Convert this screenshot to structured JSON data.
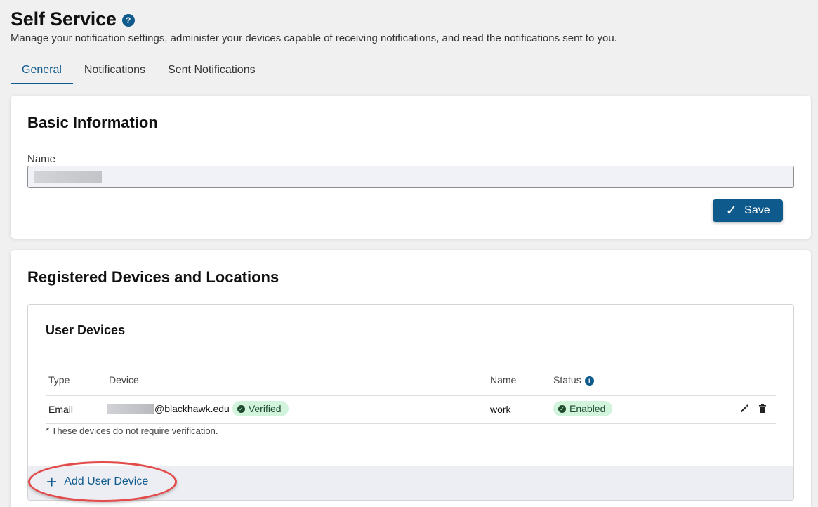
{
  "header": {
    "title": "Self Service",
    "help_icon": "question-circle-icon",
    "subtitle": "Manage your notification settings, administer your devices capable of receiving notifications, and read the notifications sent to you."
  },
  "tabs": [
    {
      "label": "General",
      "active": true
    },
    {
      "label": "Notifications",
      "active": false
    },
    {
      "label": "Sent Notifications",
      "active": false
    }
  ],
  "basic_info": {
    "title": "Basic Information",
    "name_label": "Name",
    "name_value": "",
    "save_label": "Save"
  },
  "devices": {
    "title": "Registered Devices and Locations",
    "user_devices": {
      "title": "User Devices",
      "columns": {
        "type": "Type",
        "device": "Device",
        "name": "Name",
        "status": "Status"
      },
      "rows": [
        {
          "type": "Email",
          "device_suffix": "@blackhawk.edu",
          "verification": "Verified",
          "name": "work",
          "status": "Enabled"
        }
      ],
      "footnote": "* These devices do not require verification.",
      "add_label": "Add User Device"
    }
  },
  "colors": {
    "accent": "#0f5a8c",
    "badge_bg": "#d2f3dc",
    "badge_text": "#1c4a2b",
    "highlight": "#e34b4b"
  }
}
